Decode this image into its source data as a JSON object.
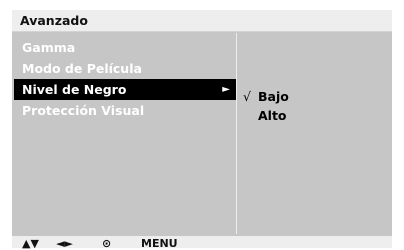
{
  "menu": {
    "title": "Avanzado",
    "items": [
      {
        "label": "Gamma"
      },
      {
        "label": "Modo de Película"
      },
      {
        "label": "Nivel de Negro"
      },
      {
        "label": "Protección Visual"
      }
    ],
    "selected_index": 2,
    "submenu": {
      "options": [
        {
          "label": "Bajo",
          "checked": true
        },
        {
          "label": "Alto",
          "checked": false
        }
      ],
      "check_mark": "√"
    }
  },
  "footer": {
    "up_down": "▲▼",
    "left_right": "◄►",
    "ok_icon": "⊙",
    "menu_label": "MENU"
  },
  "colors": {
    "panel": "#c6c6c6",
    "title_bar": "#eeeeee",
    "selection": "#000000",
    "item_text": "#ffffff",
    "option_text": "#000000"
  }
}
